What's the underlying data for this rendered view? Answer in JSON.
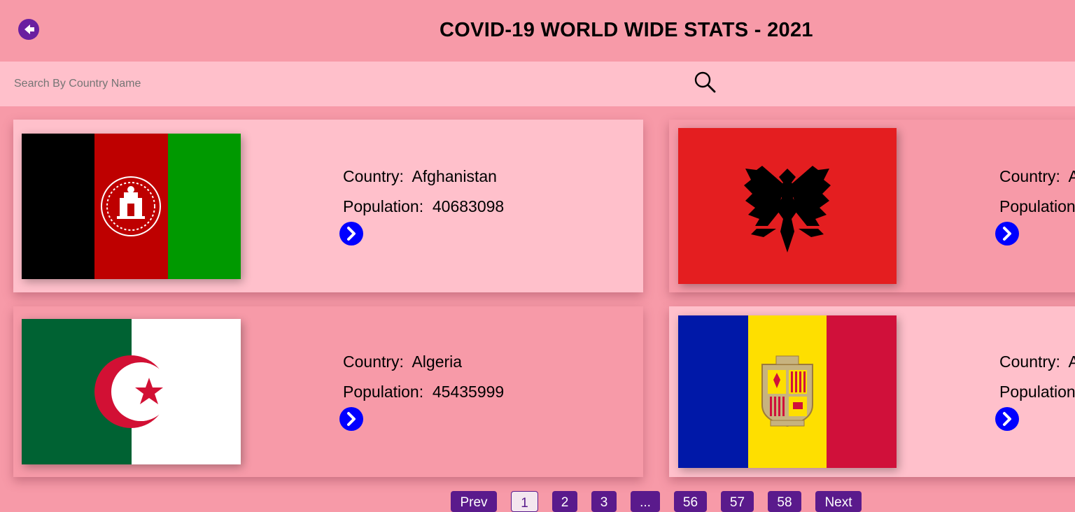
{
  "header": {
    "title": "COVID-19 WORLD WIDE STATS - 2021",
    "back_icon": "arrow-left-circle-icon",
    "accent": "#5a1a8c"
  },
  "search": {
    "placeholder": "Search By Country Name",
    "value": "",
    "icon": "search-icon"
  },
  "labels": {
    "country": "Country:",
    "population": "Population:"
  },
  "cards": [
    {
      "country": "Afghanistan",
      "population": "40683098"
    },
    {
      "country": "Albania",
      "population": ""
    },
    {
      "country": "Algeria",
      "population": "45435999"
    },
    {
      "country": "Andorra",
      "population": ""
    }
  ],
  "pagination": {
    "prev": "Prev",
    "pages": [
      "1",
      "2",
      "3",
      "...",
      "56",
      "57",
      "58"
    ],
    "next": "Next",
    "current": "1"
  },
  "colors": {
    "page_bg": "#f79aa8",
    "card_light": "#ffc0cb",
    "arrow_blue": "#0000ff"
  }
}
